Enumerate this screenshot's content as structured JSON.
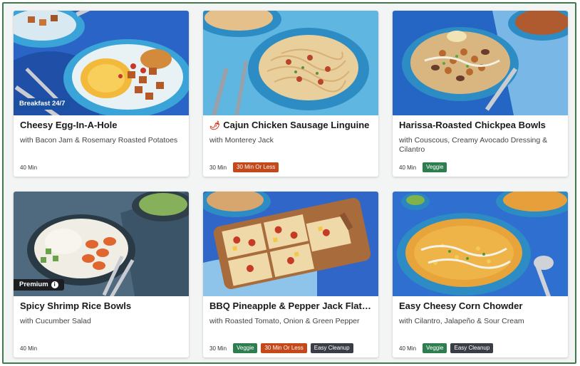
{
  "cards": [
    {
      "title": "Cheesy Egg-In-A-Hole",
      "subtitle": "with Bacon Jam & Rosemary Roasted Potatoes",
      "time": "40 Min",
      "tag": "Breakfast 24/7",
      "badges": []
    },
    {
      "title": "Cajun Chicken Sausage Linguine",
      "subtitle": "with Monterey Jack",
      "time": "30 Min",
      "icon": "chili-pepper-icon",
      "badges": [
        "30 Min Or Less"
      ]
    },
    {
      "title": "Harissa-Roasted Chickpea Bowls",
      "subtitle": "with Couscous, Creamy Avocado Dressing & Cilantro",
      "time": "40 Min",
      "badges": [
        "Veggie"
      ]
    },
    {
      "title": "Spicy Shrimp Rice Bowls",
      "subtitle": "with Cucumber Salad",
      "time": "40 Min",
      "tag": "Premium",
      "badges": []
    },
    {
      "title": "BBQ Pineapple & Pepper Jack Flatbr...",
      "subtitle": "with Roasted Tomato, Onion & Green Pepper",
      "time": "30 Min",
      "badges": [
        "Veggie",
        "30 Min Or Less",
        "Easy Cleanup"
      ]
    },
    {
      "title": "Easy Cheesy Corn Chowder",
      "subtitle": "with Cilantro, Jalapeño & Sour Cream",
      "time": "40 Min",
      "badges": [
        "Veggie",
        "Easy Cleanup"
      ]
    }
  ],
  "colors": {
    "veggie": "#2e7d4f",
    "quick": "#c4481a",
    "easy_cleanup": "#3a3d45",
    "frame": "#3f7a4c"
  }
}
